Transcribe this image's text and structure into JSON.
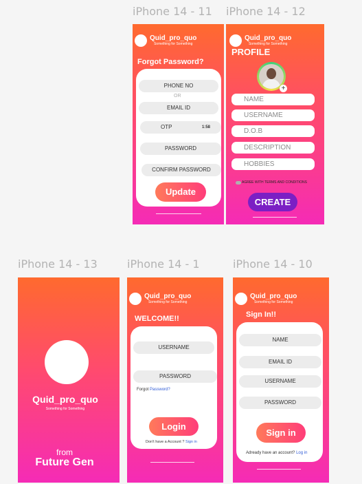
{
  "brand": {
    "name": "Quid_pro_quo",
    "tagline": "Something for Something"
  },
  "frames": {
    "f11": {
      "label": "iPhone 14 - 11",
      "title": "Forgot Password?",
      "phone_placeholder": "PHONE NO",
      "or_text": "OR",
      "email_placeholder": "EMAIL ID",
      "otp_placeholder": "OTP",
      "otp_timer": "1:58",
      "password_placeholder": "PASSWORD",
      "confirm_placeholder": "CONFIRM PASSWORD",
      "update_label": "Update"
    },
    "f12": {
      "label": "iPhone 14 - 12",
      "title": "PROFILE",
      "avatar_plus": "+",
      "name_placeholder": "NAME",
      "username_placeholder": "USERNAME",
      "dob_placeholder": "D.O.B",
      "description_placeholder": "DESCRIPTION",
      "hobbies_placeholder": "HOBBIES",
      "terms_text": "AGREE WITH TERMS AND CONDITIONS",
      "create_label": "CREATE"
    },
    "f13": {
      "label": "iPhone 14 - 13",
      "brand_name": "Quid_pro_quo",
      "tagline": "Something for Something",
      "from_text": "from",
      "company": "Future Gen"
    },
    "f1": {
      "label": "iPhone 14 - 1",
      "title": "WELCOME!!",
      "username_placeholder": "USERNAME",
      "password_placeholder": "PASSWORD",
      "forgot_text": "Forgot",
      "forgot_link": "Password?",
      "login_label": "Login",
      "no_account_text": "Don't have a Account ?",
      "signin_link": "Sign in"
    },
    "f10": {
      "label": "iPhone 14 - 10",
      "title": "Sign In!!",
      "name_placeholder": "NAME",
      "email_placeholder": "EMAIL ID",
      "username_placeholder": "USERNAME",
      "password_placeholder": "PASSWORD",
      "signin_label": "Sign in",
      "have_account_text": "Adready have an account?",
      "login_link": "Log in"
    }
  },
  "colors": {
    "gradient_top": "#ff6a2e",
    "gradient_bottom": "#f52bb6",
    "create_button": "#7b1fc4",
    "link": "#2f5bd6"
  }
}
